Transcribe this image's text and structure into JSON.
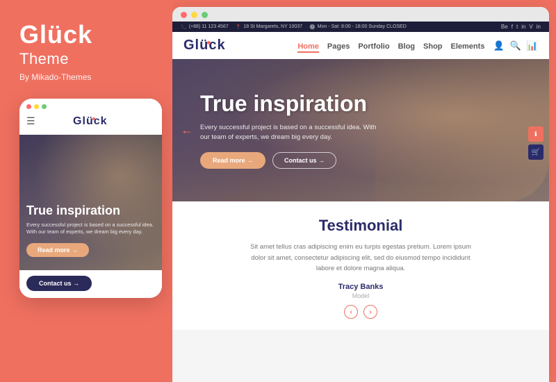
{
  "left": {
    "brand": "Glück",
    "sub": "Theme",
    "by": "By Mikado-Themes",
    "mobile": {
      "dots": [
        "red",
        "yellow",
        "green"
      ],
      "logo": "Glück",
      "hero": {
        "title": "True inspiration",
        "description": "Every successful project is based on a successful idea. With our team of experts, we dream big every day.",
        "btn_readmore": "Read more →"
      },
      "contact_btn": "Contact us →"
    }
  },
  "right": {
    "browser_dots": [
      "red",
      "yellow",
      "green"
    ],
    "topbar": {
      "phone": "(+88) 11 123 4567",
      "address": "18 St Margarets, NY 10037",
      "hours": "Mon - Sat: 8:00 - 18:00 Sunday CLOSED",
      "socials": [
        "Be",
        "f",
        "t",
        "in",
        "V",
        "in"
      ]
    },
    "navbar": {
      "logo": "Gluck",
      "links": [
        {
          "label": "Home",
          "active": true
        },
        {
          "label": "Pages",
          "active": false
        },
        {
          "label": "Portfolio",
          "active": false
        },
        {
          "label": "Blog",
          "active": false
        },
        {
          "label": "Shop",
          "active": false
        },
        {
          "label": "Elements",
          "active": false
        }
      ]
    },
    "hero": {
      "title": "True inspiration",
      "description": "Every successful project is based on a successful idea. With our team of experts, we dream big every day.",
      "btn_readmore": "Read more →",
      "btn_contact": "Contact us →",
      "nav_left": "←",
      "nav_right": "→"
    },
    "testimonial": {
      "title": "Testimonial",
      "text": "Sit amet tellus cras adipiscing enim eu turpis egestas pretium. Lorem ipsum dolor sit amet, consectetur adipiscing elit, sed do eiusmod tempo incididunt labore et dolore magna aliqua.",
      "author": "Tracy Banks",
      "role": "Model",
      "nav_prev": "‹",
      "nav_next": "›"
    }
  },
  "contact_us_label": "Contact US"
}
